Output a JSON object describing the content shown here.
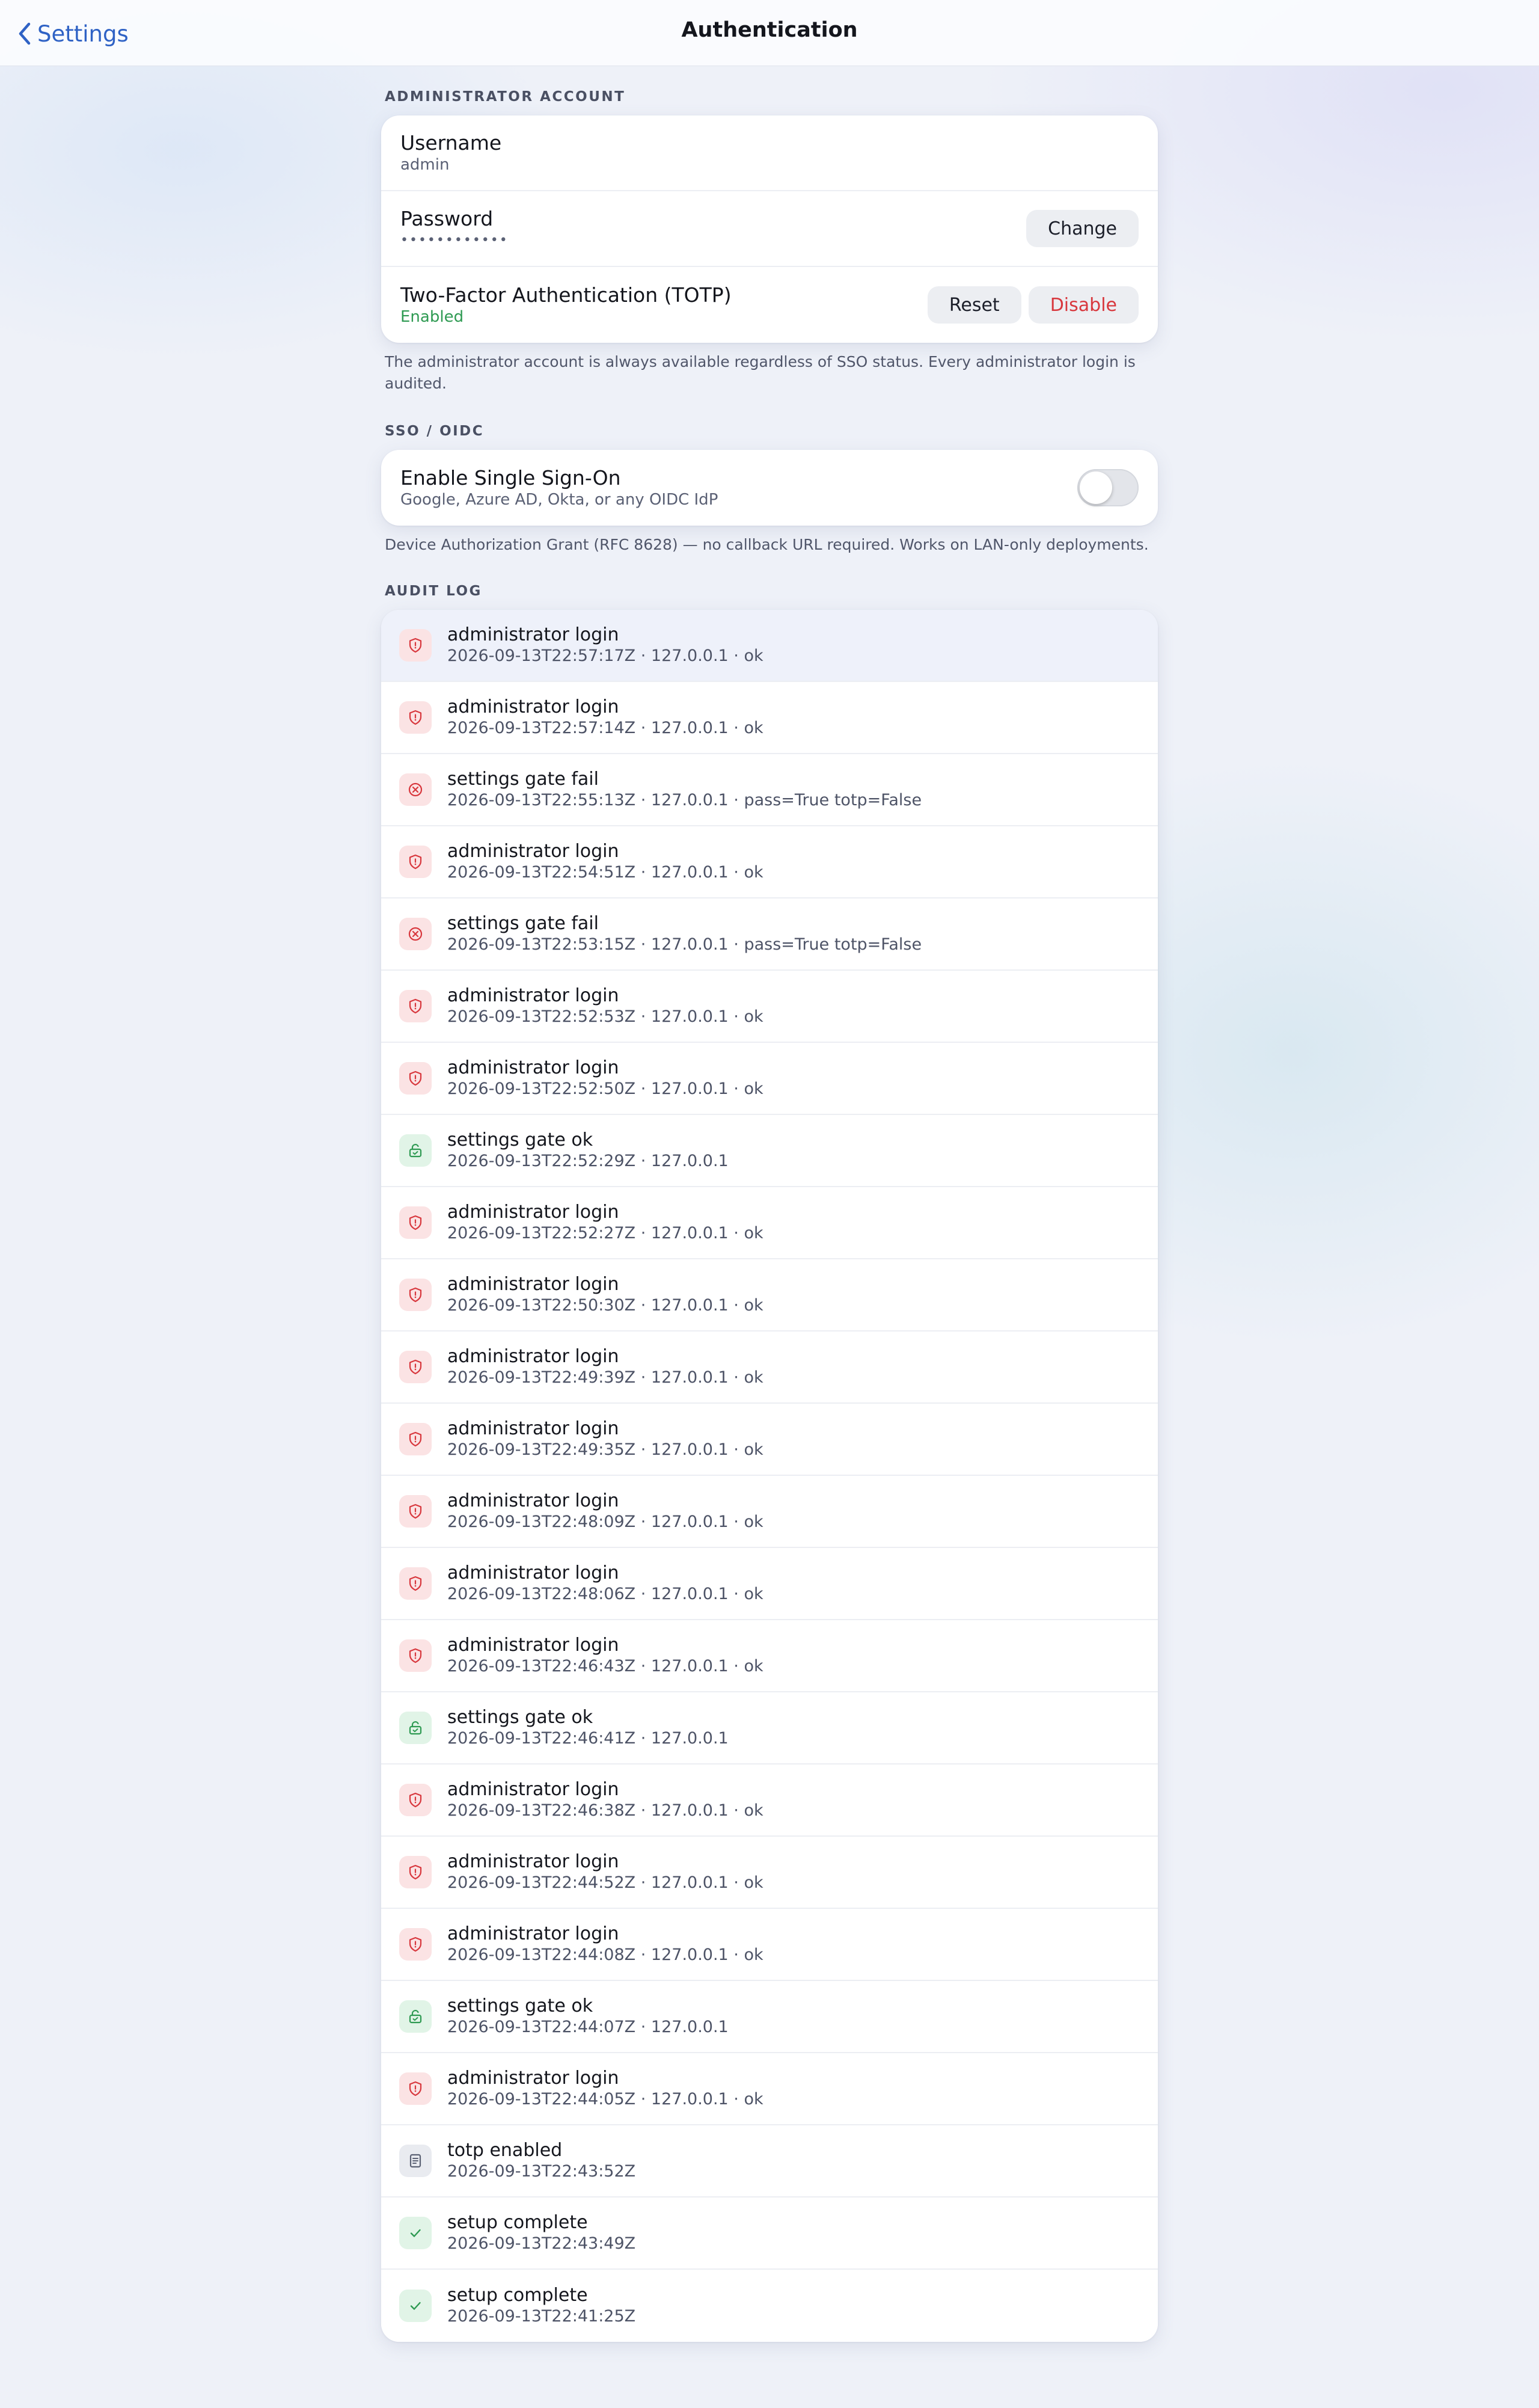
{
  "nav": {
    "back_label": "Settings",
    "title": "Authentication"
  },
  "admin": {
    "header": "ADMINISTRATOR ACCOUNT",
    "username_label": "Username",
    "username_value": "admin",
    "password_label": "Password",
    "password_value": "••••••••••••",
    "change_label": "Change",
    "totp_label": "Two-Factor Authentication (TOTP)",
    "totp_status": "Enabled",
    "reset_label": "Reset",
    "disable_label": "Disable",
    "footnote": "The administrator account is always available regardless of SSO status. Every administrator login is audited."
  },
  "sso": {
    "header": "SSO / OIDC",
    "enable_label": "Enable Single Sign-On",
    "enable_sub": "Google, Azure AD, Okta, or any OIDC IdP",
    "enabled": false,
    "footnote": "Device Authorization Grant (RFC 8628) — no callback URL required. Works on LAN-only deployments."
  },
  "audit": {
    "header": "AUDIT LOG",
    "entries": [
      {
        "title": "administrator login",
        "detail": "2026-09-13T22:57:17Z · 127.0.0.1 · ok",
        "icon": "shield-icon"
      },
      {
        "title": "administrator login",
        "detail": "2026-09-13T22:57:14Z · 127.0.0.1 · ok",
        "icon": "shield-icon"
      },
      {
        "title": "settings gate fail",
        "detail": "2026-09-13T22:55:13Z · 127.0.0.1 · pass=True totp=False",
        "icon": "x-circle-icon"
      },
      {
        "title": "administrator login",
        "detail": "2026-09-13T22:54:51Z · 127.0.0.1 · ok",
        "icon": "shield-icon"
      },
      {
        "title": "settings gate fail",
        "detail": "2026-09-13T22:53:15Z · 127.0.0.1 · pass=True totp=False",
        "icon": "x-circle-icon"
      },
      {
        "title": "administrator login",
        "detail": "2026-09-13T22:52:53Z · 127.0.0.1 · ok",
        "icon": "shield-icon"
      },
      {
        "title": "administrator login",
        "detail": "2026-09-13T22:52:50Z · 127.0.0.1 · ok",
        "icon": "shield-icon"
      },
      {
        "title": "settings gate ok",
        "detail": "2026-09-13T22:52:29Z · 127.0.0.1",
        "icon": "unlock-icon"
      },
      {
        "title": "administrator login",
        "detail": "2026-09-13T22:52:27Z · 127.0.0.1 · ok",
        "icon": "shield-icon"
      },
      {
        "title": "administrator login",
        "detail": "2026-09-13T22:50:30Z · 127.0.0.1 · ok",
        "icon": "shield-icon"
      },
      {
        "title": "administrator login",
        "detail": "2026-09-13T22:49:39Z · 127.0.0.1 · ok",
        "icon": "shield-icon"
      },
      {
        "title": "administrator login",
        "detail": "2026-09-13T22:49:35Z · 127.0.0.1 · ok",
        "icon": "shield-icon"
      },
      {
        "title": "administrator login",
        "detail": "2026-09-13T22:48:09Z · 127.0.0.1 · ok",
        "icon": "shield-icon"
      },
      {
        "title": "administrator login",
        "detail": "2026-09-13T22:48:06Z · 127.0.0.1 · ok",
        "icon": "shield-icon"
      },
      {
        "title": "administrator login",
        "detail": "2026-09-13T22:46:43Z · 127.0.0.1 · ok",
        "icon": "shield-icon"
      },
      {
        "title": "settings gate ok",
        "detail": "2026-09-13T22:46:41Z · 127.0.0.1",
        "icon": "unlock-icon"
      },
      {
        "title": "administrator login",
        "detail": "2026-09-13T22:46:38Z · 127.0.0.1 · ok",
        "icon": "shield-icon"
      },
      {
        "title": "administrator login",
        "detail": "2026-09-13T22:44:52Z · 127.0.0.1 · ok",
        "icon": "shield-icon"
      },
      {
        "title": "administrator login",
        "detail": "2026-09-13T22:44:08Z · 127.0.0.1 · ok",
        "icon": "shield-icon"
      },
      {
        "title": "settings gate ok",
        "detail": "2026-09-13T22:44:07Z · 127.0.0.1",
        "icon": "unlock-icon"
      },
      {
        "title": "administrator login",
        "detail": "2026-09-13T22:44:05Z · 127.0.0.1 · ok",
        "icon": "shield-icon"
      },
      {
        "title": "totp enabled",
        "detail": "2026-09-13T22:43:52Z",
        "icon": "document-icon"
      },
      {
        "title": "setup complete",
        "detail": "2026-09-13T22:43:49Z",
        "icon": "checkmark-icon"
      },
      {
        "title": "setup complete",
        "detail": "2026-09-13T22:41:25Z",
        "icon": "checkmark-icon"
      }
    ]
  },
  "colors": {
    "accent": "#2f62c5",
    "danger": "#d8373d",
    "success": "#2e9a52"
  }
}
